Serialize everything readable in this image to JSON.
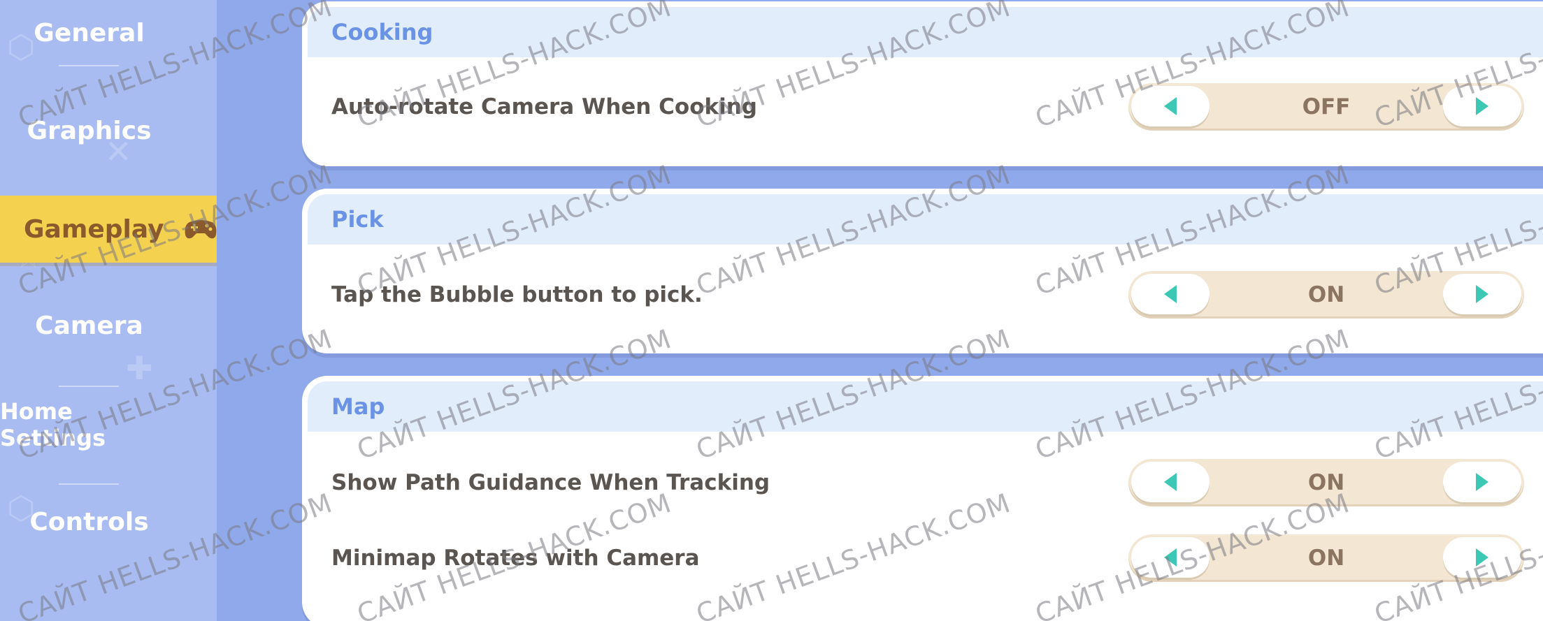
{
  "sidebar": {
    "items": [
      {
        "label": "General",
        "active": false
      },
      {
        "label": "Graphics",
        "active": false
      },
      {
        "label": "Gameplay",
        "active": true
      },
      {
        "label": "Camera",
        "active": false
      },
      {
        "label": "Home Settings",
        "active": false
      },
      {
        "label": "Controls",
        "active": false
      }
    ]
  },
  "sections": [
    {
      "title": "Cooking",
      "rows": [
        {
          "label": "Auto-rotate Camera When Cooking",
          "value": "OFF"
        }
      ]
    },
    {
      "title": "Pick",
      "rows": [
        {
          "label": "Tap the Bubble button to pick.",
          "value": "ON"
        }
      ]
    },
    {
      "title": "Map",
      "rows": [
        {
          "label": "Show Path Guidance When Tracking",
          "value": "ON"
        },
        {
          "label": "Minimap Rotates with Camera",
          "value": "ON"
        }
      ]
    }
  ],
  "watermark": "САЙТ HELLS-HACK.COM",
  "colors": {
    "accent_active": "#f5d150",
    "arrow": "#3cc8b4",
    "section_title": "#6b93e5",
    "background": "#90a9ea"
  }
}
